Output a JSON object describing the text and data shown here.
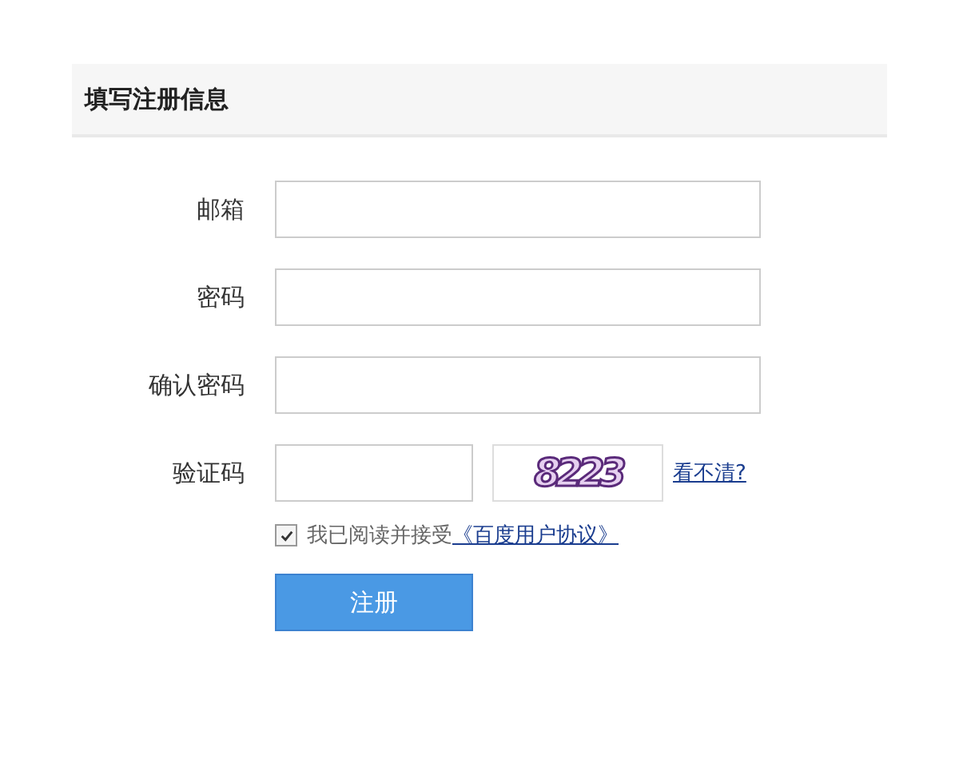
{
  "header": {
    "title": "填写注册信息"
  },
  "fields": [
    {
      "kind": "text",
      "label": "邮箱"
    },
    {
      "kind": "text",
      "label": "密码"
    },
    {
      "kind": "text",
      "label": "确认密码"
    },
    {
      "kind": "captcha",
      "label": "验证码",
      "captcha": "8223",
      "refresh_link": "看不清?"
    }
  ],
  "agreement": {
    "checked": true,
    "text": "我已阅读并接受",
    "link": "《百度用户协议》"
  },
  "submit": {
    "label": "注册"
  }
}
